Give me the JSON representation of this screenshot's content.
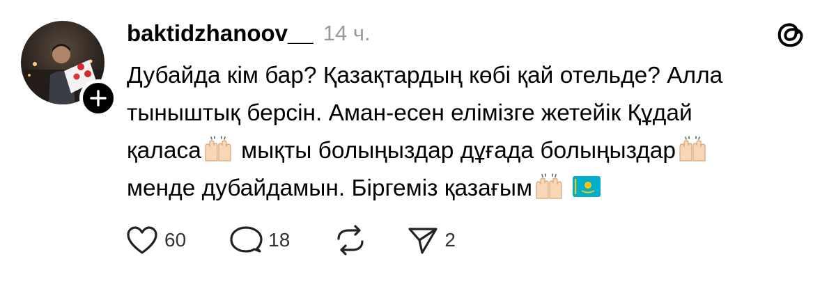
{
  "post": {
    "username": "baktidzhanoov__",
    "time": "14 ч.",
    "text_lines": [
      "Дубайда кім бар? Қазақтардың көбі қай отельде? Алла",
      "тыныштық берсін. Аман-есен елімізге жетейік Құдай",
      "қаласа",
      "мықты болыңыздар дұғада болыңыздар",
      "менде дубайдамын. Біргеміз қазағым"
    ],
    "emoji": {
      "raised_hands": "raising-hands-emoji",
      "flag": "kazakhstan-flag-emoji"
    }
  },
  "actions": {
    "likes": "60",
    "replies": "18",
    "shares": "2"
  },
  "icons": [
    "heart-icon",
    "comment-icon",
    "repost-icon",
    "send-icon",
    "threads-logo-icon",
    "plus-icon"
  ],
  "colors": {
    "text": "#000000",
    "muted": "#9a9a9a",
    "flag_blue": "#00AFCA",
    "flag_gold": "#FEC50C"
  }
}
